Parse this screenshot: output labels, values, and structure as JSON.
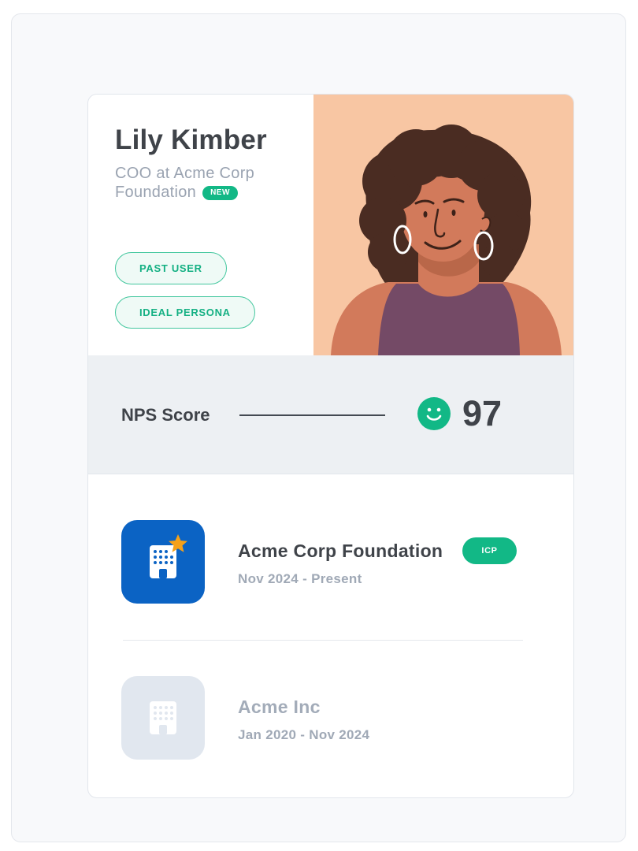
{
  "profile": {
    "name": "Lily Kimber",
    "role": "COO at Acme Corp Foundation",
    "new_badge": "NEW",
    "tags": [
      "PAST USER",
      "IDEAL PERSONA"
    ],
    "avatar_icon": "person-portrait"
  },
  "nps": {
    "label": "NPS Score",
    "value": "97",
    "icon": "smiley-icon",
    "color": "#12b886"
  },
  "companies": [
    {
      "name": "Acme Corp Foundation",
      "dates": "Nov 2024 - Present",
      "badge": "ICP",
      "icon": "building-star-icon",
      "logo_color": "#0b63c4"
    },
    {
      "name": "Acme Inc",
      "dates": "Jan 2020 - Nov 2024",
      "icon": "building-icon",
      "logo_color": "#e1e7ef"
    }
  ],
  "colors": {
    "accent_green": "#12b886",
    "brand_blue": "#0b63c4",
    "star_orange": "#f5a11a",
    "portrait_bg": "#f8c6a3"
  }
}
